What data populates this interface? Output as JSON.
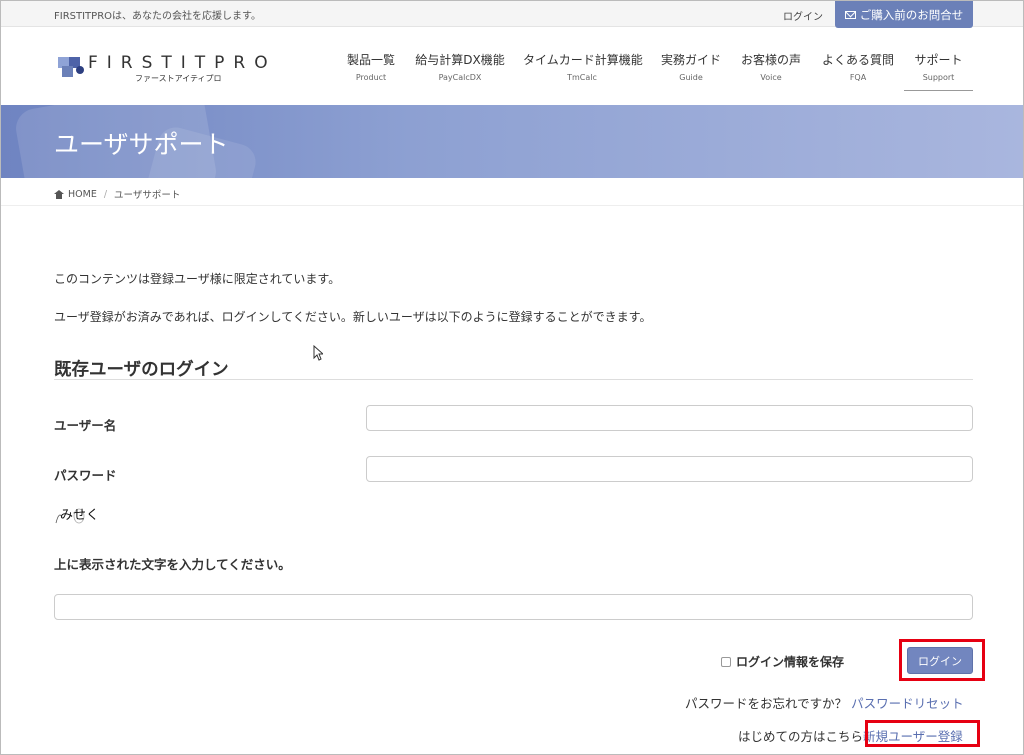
{
  "topbar": {
    "tagline": "FIRSTITPROは、あなたの会社を応援します。",
    "login_label": "ログイン",
    "contact_label": "ご購入前のお問合せ"
  },
  "logo": {
    "text": "FIRSTITPRO",
    "subtext": "ファーストアイティプロ"
  },
  "nav": [
    {
      "jp": "製品一覧",
      "en": "Product"
    },
    {
      "jp": "給与計算DX機能",
      "en": "PayCalcDX"
    },
    {
      "jp": "タイムカード計算機能",
      "en": "TmCalc"
    },
    {
      "jp": "実務ガイド",
      "en": "Guide"
    },
    {
      "jp": "お客様の声",
      "en": "Voice"
    },
    {
      "jp": "よくある質問",
      "en": "FQA"
    },
    {
      "jp": "サポート",
      "en": "Support"
    }
  ],
  "banner": {
    "title": "ユーザサポート"
  },
  "breadcrumb": {
    "home": "HOME",
    "current": "ユーザサポート"
  },
  "content": {
    "notice": "このコンテンツは登録ユーザ様に限定されています。",
    "instructions": "ユーザ登録がお済みであれば、ログインしてください。新しいユーザは以下のように登録することができます。",
    "section_title": "既存ユーザのログイン",
    "username_label": "ユーザー名",
    "password_label": "パスワード",
    "captcha_text": "みせく",
    "captcha_instruction": "上に表示された文字を入力してください。",
    "remember_label": "ログイン情報を保存",
    "login_button": "ログイン",
    "forgot_text": "パスワードをお忘れですか？",
    "forgot_link": "パスワードリセット",
    "first_time_text": "はじめての方はこちら",
    "register_link": "新規ユーザー登録"
  },
  "colors": {
    "accent": "#6b80b8",
    "highlight_border": "#e60012",
    "link": "#5a6fb0"
  }
}
